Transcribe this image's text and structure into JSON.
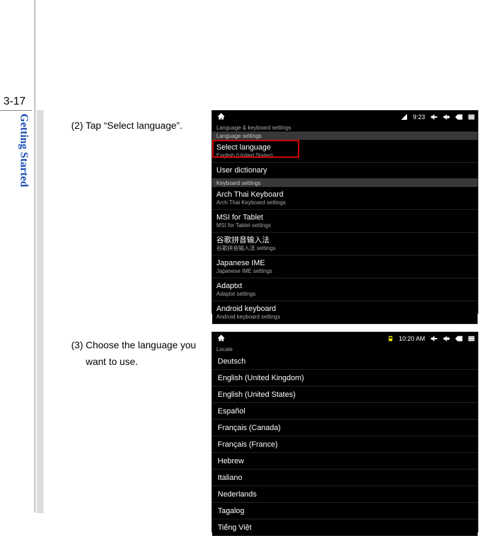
{
  "page_number": "3-17",
  "side_title": "Getting Started",
  "instructions": {
    "step2": "(2) Tap “Select language”.",
    "step3": "(3) Choose the language you want to use."
  },
  "shot1": {
    "time": "9:23",
    "crumb": "Language & keyboard settings",
    "section1": "Language settings",
    "select_language": {
      "title": "Select language",
      "sub": "English (United States)"
    },
    "user_dictionary": {
      "title": "User dictionary"
    },
    "section2": "Keyboard settings",
    "kb": [
      {
        "title": "Arch Thai Keyboard",
        "sub": "Arch Thai Keyboard settings"
      },
      {
        "title": "MSI for Tablet",
        "sub": "MSI for Tablet settings"
      },
      {
        "title": "谷歌拼音输入法",
        "sub": "谷歌拼音输入法 settings"
      },
      {
        "title": "Japanese IME",
        "sub": "Japanese IME settings"
      },
      {
        "title": "Adaptxt",
        "sub": "Adaptxt settings"
      },
      {
        "title": "Android keyboard",
        "sub": "Android keyboard settings"
      }
    ]
  },
  "shot2": {
    "time": "10:20 AM",
    "crumb": "Locale",
    "langs": [
      "Deutsch",
      "English (United Kingdom)",
      "English (United States)",
      "Español",
      "Français (Canada)",
      "Français (France)",
      "Hebrew",
      "Italiano",
      "Nederlands",
      "Tagalog",
      "Tiếng Việt"
    ]
  }
}
